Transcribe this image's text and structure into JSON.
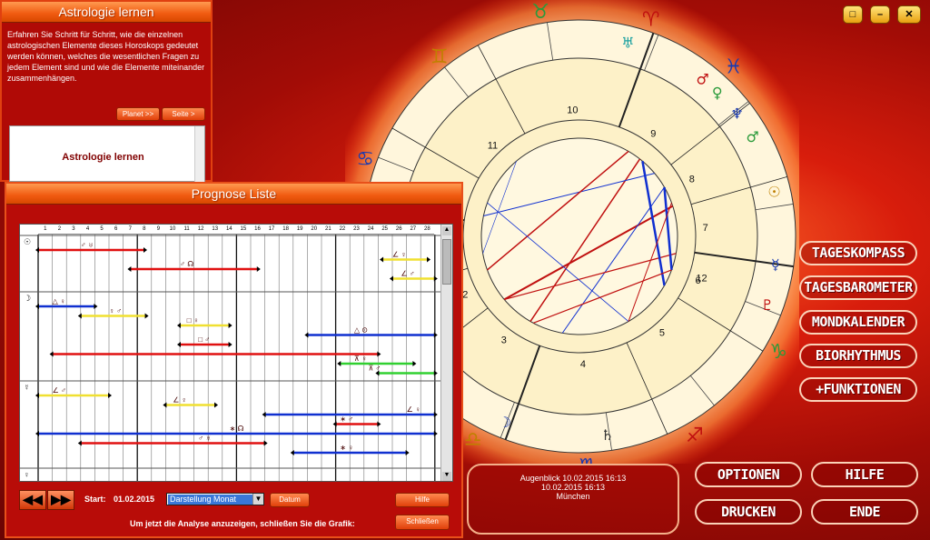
{
  "astro_panel": {
    "title": "Astrologie lernen",
    "description": "Erfahren Sie Schritt für Schritt, wie die einzelnen astrologischen Elemente dieses Horoskops gedeutet werden können, welches die wesentlichen Fragen zu jedem Element sind und wie die Elemente miteinander zusammenhängen.",
    "btn_planet": "Planet >>",
    "btn_seite": "Seite >",
    "box_title": "Astrologie lernen"
  },
  "prognose": {
    "title": "Prognose Liste",
    "day_numbers": [
      "1",
      "2",
      "3",
      "4",
      "5",
      "6",
      "7",
      "8",
      "9",
      "10",
      "11",
      "12",
      "13",
      "14",
      "15",
      "16",
      "17",
      "18",
      "19",
      "20",
      "21",
      "22",
      "23",
      "24",
      "25",
      "26",
      "27",
      "28"
    ],
    "row_symbols": [
      "☉",
      "☽",
      "☿",
      "♀"
    ],
    "start_label": "Start:",
    "start_value": "01.02.2015",
    "select_value": "Darstellung Monat",
    "datum_btn": "Datum",
    "hilfe_btn": "Hilfe",
    "hint": "Um jetzt die Analyse anzuzeigen, schließen Sie die Grafik:",
    "close_btn": "Schließen",
    "bars": [
      {
        "row": 0,
        "d1": 1,
        "d2": 7.5,
        "color": "#e01010",
        "sym": "♂ ♅",
        "sp": 4
      },
      {
        "row": 0,
        "d1": 25.3,
        "d2": 27.5,
        "color": "#f0e030",
        "sym": "∠ ♀",
        "sp": 26
      },
      {
        "row": 0,
        "d1": 7.5,
        "d2": 15.5,
        "color": "#e01010",
        "sym": "♂ ☊",
        "sp": 11
      },
      {
        "row": 0,
        "d1": 26,
        "d2": 28,
        "color": "#f0e030",
        "sym": "∠ ♂",
        "sp": 26.6
      },
      {
        "row": 1,
        "d1": 1,
        "d2": 4,
        "color": "#1030d0",
        "sym": "△ ♀",
        "sp": 2
      },
      {
        "row": 1,
        "d1": 4,
        "d2": 7.6,
        "color": "#f0e030",
        "sym": "♀ ♂",
        "sp": 6
      },
      {
        "row": 1,
        "d1": 11,
        "d2": 13.5,
        "color": "#f0e030",
        "sym": "□ ♀",
        "sp": 11.5
      },
      {
        "row": 1,
        "d1": 20,
        "d2": 28,
        "color": "#1030d0",
        "sym": "△ ⊙",
        "sp": 23.3
      },
      {
        "row": 1,
        "d1": 11,
        "d2": 13.5,
        "color": "#e01010",
        "sym": "□ ♂",
        "sp": 12.3
      },
      {
        "row": 1,
        "d1": 2,
        "d2": 24,
        "color": "#e01010",
        "sym": "",
        "sp": 0
      },
      {
        "row": 1,
        "d1": 22.3,
        "d2": 26.5,
        "color": "#30d030",
        "sym": "⊼ ♀",
        "sp": 23.3
      },
      {
        "row": 1,
        "d1": 25,
        "d2": 28,
        "color": "#30d030",
        "sym": "⊼ ♂",
        "sp": 24.3
      },
      {
        "row": 2,
        "d1": 1,
        "d2": 5,
        "color": "#f0e030",
        "sym": "∠ ♂",
        "sp": 2
      },
      {
        "row": 2,
        "d1": 10,
        "d2": 12.5,
        "color": "#f0e030",
        "sym": "∠ ♀",
        "sp": 10.5
      },
      {
        "row": 2,
        "d1": 17,
        "d2": 28,
        "color": "#1030d0",
        "sym": "∠ ♀",
        "sp": 27
      },
      {
        "row": 2,
        "d1": 22,
        "d2": 24,
        "color": "#e01010",
        "sym": "∗ ♂",
        "sp": 22.3
      },
      {
        "row": 2,
        "d1": 1,
        "d2": 28,
        "color": "#1030d0",
        "sym": "∗ ☊",
        "sp": 14.5
      },
      {
        "row": 2,
        "d1": 4,
        "d2": 16,
        "color": "#e01010",
        "sym": "♂ ♅",
        "sp": 12.3
      },
      {
        "row": 2,
        "d1": 19,
        "d2": 26,
        "color": "#1030d0",
        "sym": "∗ ♀",
        "sp": 22.3
      }
    ]
  },
  "info": {
    "line1": "Augenblick 10.02.2015 16:13",
    "line2": "10.02.2015  16:13",
    "line3": "München"
  },
  "buttons": {
    "tageskompass": "TAGESKOMPASS",
    "tagesbarometer": "TAGESBAROMETER",
    "mondkalender": "MONDKALENDER",
    "biorhythmus": "BIORHYTHMUS",
    "funktionen": "+FUNKTIONEN",
    "optionen": "OPTIONEN",
    "hilfe": "HILFE",
    "drucken": "DRUCKEN",
    "ende": "ENDE"
  },
  "chart": {
    "houses": [
      "1",
      "2",
      "3",
      "4",
      "5",
      "6",
      "7",
      "8",
      "9",
      "10",
      "11",
      "12"
    ],
    "zodiac": [
      {
        "g": "♉",
        "c": "#2a9a3a",
        "a": 100
      },
      {
        "g": "♈",
        "c": "#c01010",
        "a": 72
      },
      {
        "g": "♓",
        "c": "#1a3ab0",
        "a": 48
      },
      {
        "g": "♒",
        "c": "#c08000",
        "a": 8
      },
      {
        "g": "♑",
        "c": "#2a9a3a",
        "a": -30
      },
      {
        "g": "♐",
        "c": "#c01010",
        "a": -60
      },
      {
        "g": "♏",
        "c": "#1a3ab0",
        "a": -88
      },
      {
        "g": "♎",
        "c": "#c08000",
        "a": -118
      },
      {
        "g": "♍",
        "c": "#2a9a3a",
        "a": -150
      },
      {
        "g": "♌",
        "c": "#c01010",
        "a": 182
      },
      {
        "g": "♋",
        "c": "#1a3ab0",
        "a": 160
      },
      {
        "g": "♊",
        "c": "#c08000",
        "a": 128
      }
    ],
    "planets": [
      {
        "g": "♅",
        "c": "#1aa0a0",
        "a": 76
      },
      {
        "g": "♂",
        "c": "#c01010",
        "a": 52
      },
      {
        "g": "♀",
        "c": "#2a9a3a",
        "a": 46
      },
      {
        "g": "♆",
        "c": "#1a3ab0",
        "a": 38
      },
      {
        "g": "♂",
        "c": "#2a9a3a",
        "a": 30
      },
      {
        "g": "☉",
        "c": "#c08000",
        "a": 13
      },
      {
        "g": "☿",
        "c": "#1a3ab0",
        "a": -8
      },
      {
        "g": "♇",
        "c": "#c01010",
        "a": -20
      },
      {
        "g": "♄",
        "c": "#333",
        "a": -82
      },
      {
        "g": "☽",
        "c": "#1a3ab0",
        "a": -112
      },
      {
        "g": "♃",
        "c": "#c01010",
        "a": -150
      }
    ]
  }
}
